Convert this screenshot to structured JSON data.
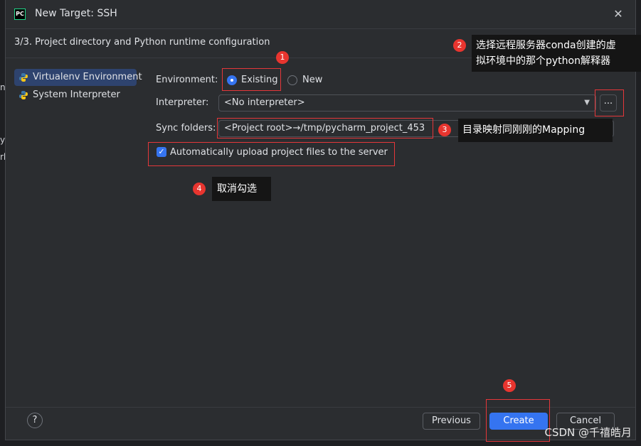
{
  "backdrop": {
    "fragments": [
      "n",
      "y",
      "rl"
    ]
  },
  "window": {
    "title": "New Target: SSH",
    "logo_text": "PC",
    "close_glyph": "✕"
  },
  "step_title": "3/3. Project directory and Python runtime configuration",
  "sidebar": {
    "items": [
      {
        "label": "Virtualenv Environment",
        "selected": true,
        "icon": "python-icon"
      },
      {
        "label": "System Interpreter",
        "selected": false,
        "icon": "python-icon"
      }
    ]
  },
  "form": {
    "environment_label": "Environment:",
    "options": [
      {
        "label": "Existing",
        "selected": true
      },
      {
        "label": "New",
        "selected": false
      }
    ],
    "interpreter_label": "Interpreter:",
    "interpreter_value": "<No interpreter>",
    "browse_label": "...",
    "sync_label": "Sync folders:",
    "sync_value": "<Project root>→/tmp/pycharm_project_453",
    "upload_label": "Automatically upload project files to the server",
    "upload_checked": true
  },
  "annotations": {
    "badges": [
      "1",
      "2",
      "3",
      "4",
      "5"
    ],
    "note2_line1": "选择远程服务器conda创建的虚",
    "note2_line2": "拟环境中的那个python解释器",
    "note3": "目录映射同刚刚的Mapping",
    "note4": "取消勾选",
    "color": "#e5373a"
  },
  "footer": {
    "help_glyph": "?",
    "previous_label": "Previous",
    "create_label": "Create",
    "cancel_label": "Cancel"
  },
  "watermark": "CSDN @千禧皓月",
  "colors": {
    "accent": "#3574f0",
    "background": "#2b2d30",
    "selection": "#2e436e"
  }
}
